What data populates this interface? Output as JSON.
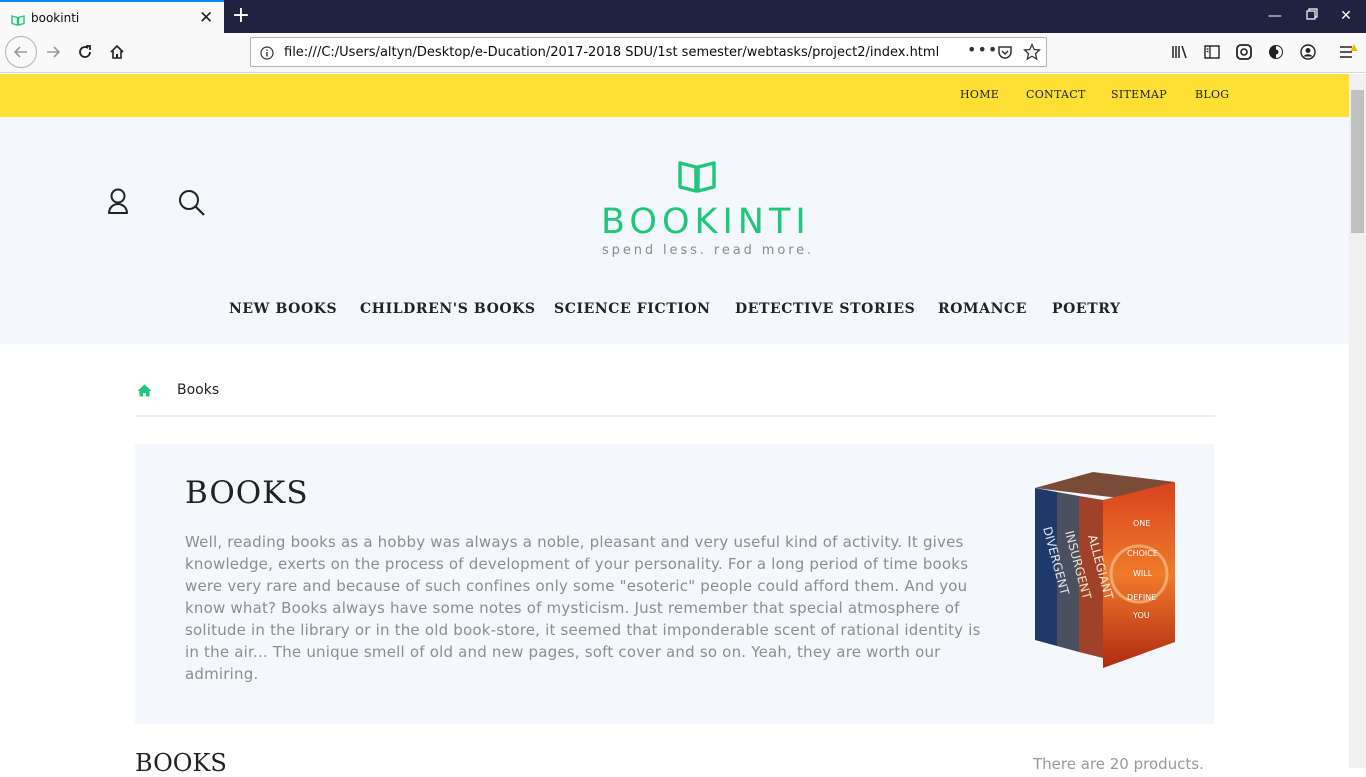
{
  "browser": {
    "tab_title": "bookinti",
    "url": "file:///C:/Users/altyn/Desktop/e-Ducation/2017-2018 SDU/1st semester/webtasks/project2/index.html",
    "url_more": "•••"
  },
  "topbar": {
    "links": [
      "HOME",
      "CONTACT",
      "SITEMAP",
      "BLOG"
    ]
  },
  "header": {
    "brand": "BOOKINTI",
    "tagline": "spend less. read more.",
    "categories": [
      "NEW BOOKS",
      "CHILDREN'S BOOKS",
      "SCIENCE FICTION",
      "DETECTIVE STORIES",
      "ROMANCE",
      "POETRY"
    ]
  },
  "breadcrumb": {
    "current": "Books"
  },
  "intro": {
    "title": "BOOKS",
    "text": "Well, reading books as a hobby was always a noble, pleasant and very useful kind of activity. It gives knowledge, exerts on the process of development of your personality. For a long period of time books were very rare and because of such confines only some \"esoteric\" people could afford them. And you know what? Books always have some notes of mysticism. Just remember that special atmosphere of solitude in the library or in the old book-store, it seemed that imponderable scent of rational identity is in the air... The unique smell of old and new pages, soft cover and so on. Yeah, they are worth our admiring.",
    "image_spines": [
      "DIVERGENT",
      "INSURGENT",
      "ALLEGIANT"
    ],
    "image_cover_lines": [
      "ONE",
      "CHOICE",
      "WILL",
      "DEFINE",
      "YOU"
    ]
  },
  "products": {
    "title": "BOOKS",
    "count_text": "There are 20 products."
  },
  "colors": {
    "accent": "#1ec77b",
    "topbar": "#fedf33",
    "header_bg": "#f4f7fb"
  }
}
